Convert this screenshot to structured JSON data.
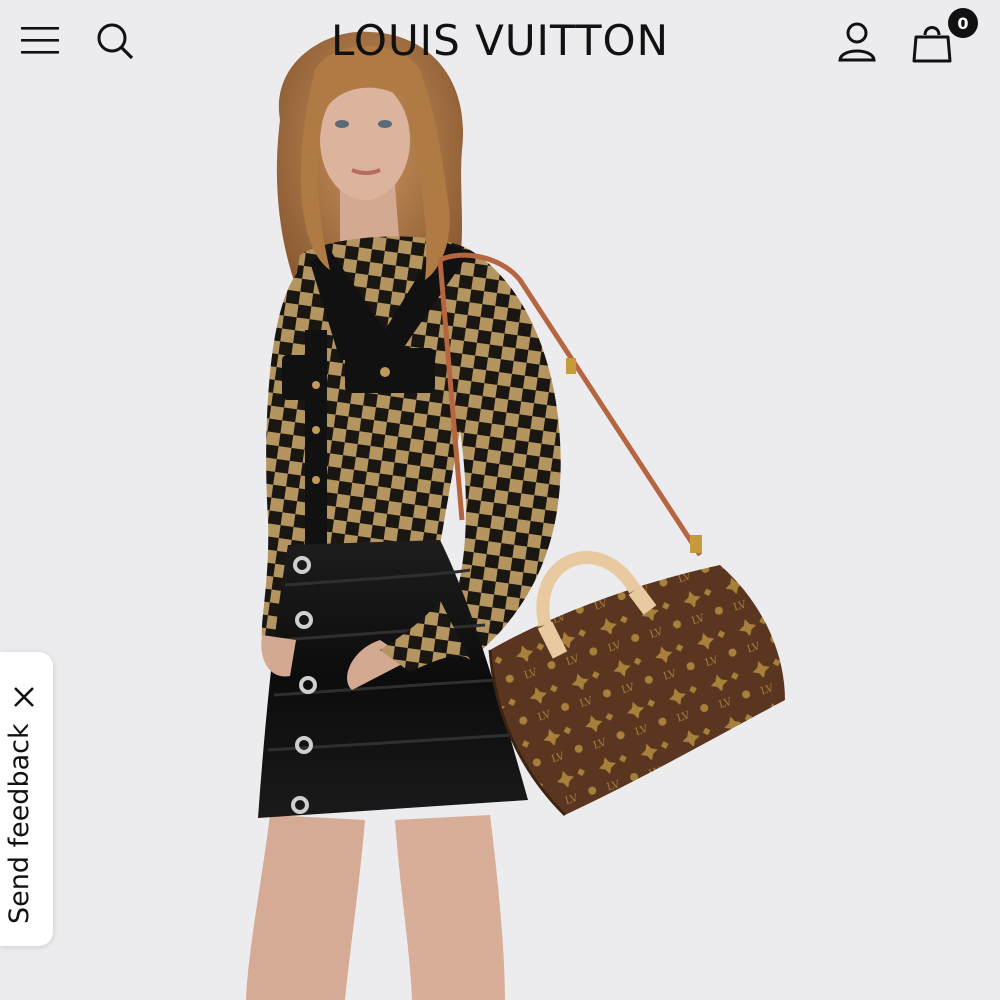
{
  "header": {
    "logo_text": "LOUIS VUITTON",
    "menu_icon": "hamburger-menu-icon",
    "search_icon": "search-icon",
    "account_icon": "user-account-icon",
    "cart_icon": "shopping-bag-icon",
    "cart_count": "0"
  },
  "feedback": {
    "label": "Send feedback",
    "close_icon": "close-icon"
  },
  "hero": {
    "background_color": "#ececee"
  }
}
